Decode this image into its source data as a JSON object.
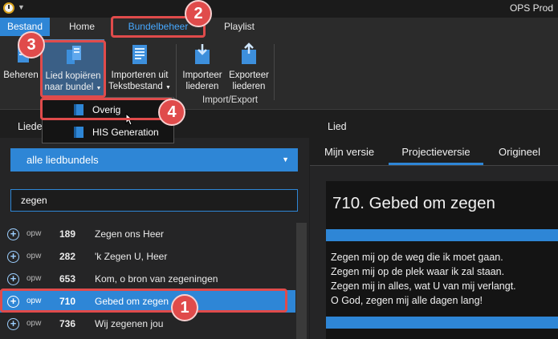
{
  "app": {
    "title": "OPS Prod"
  },
  "tabs": {
    "file": "Bestand",
    "home": "Home",
    "bundelbeheer": "Bundelbeheer",
    "playlist": "Playlist"
  },
  "ribbon": {
    "beheren": "Beheren",
    "lied_kopieren_line1": "Lied kopiëren",
    "lied_kopieren_line2": "naar bundel",
    "importeren_line1": "Importeren uit",
    "importeren_line2": "Tekstbestand",
    "importeer_line1": "Importeer",
    "importeer_line2": "liederen",
    "exporteer_line1": "Exporteer",
    "exporteer_line2": "liederen",
    "group_import_export": "Import/Export"
  },
  "popup": {
    "items": [
      "Overig",
      "HIS Generation"
    ]
  },
  "left": {
    "header": "Liede",
    "dropdown": "alle liedbundels",
    "search_value": "zegen",
    "songs": [
      {
        "book": "opw",
        "number": "189",
        "title": "Zegen ons Heer"
      },
      {
        "book": "opw",
        "number": "282",
        "title": "'k Zegen U, Heer"
      },
      {
        "book": "opw",
        "number": "653",
        "title": "Kom, o bron van zegeningen"
      },
      {
        "book": "opw",
        "number": "710",
        "title": "Gebed om zegen"
      },
      {
        "book": "opw",
        "number": "736",
        "title": "Wij zegenen jou"
      }
    ]
  },
  "right": {
    "header": "Lied",
    "tabs": [
      "Mijn versie",
      "Projectieversie",
      "Origineel"
    ],
    "preview_title": "710. Gebed om zegen",
    "preview_lines": [
      "Zegen mij op de weg die ik moet gaan.",
      "Zegen mij op de plek waar ik zal staan.",
      "Zegen mij in alles, wat U van mij verlangt.",
      "O God, zegen mij alle dagen lang!"
    ]
  },
  "annotations": {
    "badges": [
      "1",
      "2",
      "3",
      "4"
    ],
    "color": "#e04b4b"
  },
  "colors": {
    "accent": "#2e86d6",
    "background": "#1e1e1e"
  }
}
